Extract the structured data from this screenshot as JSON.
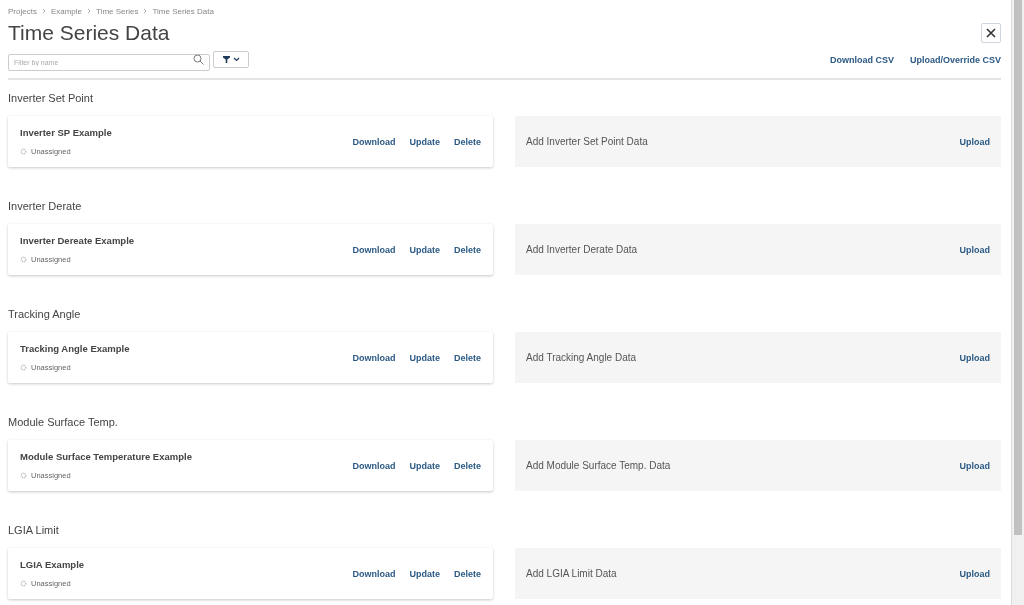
{
  "breadcrumb": [
    "Projects",
    "Example",
    "Time Series",
    "Time Series Data"
  ],
  "title": "Time Series Data",
  "filter": {
    "placeholder": "Filter by name"
  },
  "header_actions": [
    "Download CSV",
    "Upload/Override CSV"
  ],
  "sections": [
    {
      "title": "Inverter Set Point",
      "item": {
        "name": "Inverter SP Example",
        "status": "Unassigned",
        "actions": [
          "Download",
          "Update",
          "Delete"
        ]
      },
      "add": {
        "label": "Add Inverter Set Point Data",
        "action": "Upload"
      }
    },
    {
      "title": "Inverter Derate",
      "item": {
        "name": "Inverter Dereate Example",
        "status": "Unassigned",
        "actions": [
          "Download",
          "Update",
          "Delete"
        ]
      },
      "add": {
        "label": "Add Inverter Derate Data",
        "action": "Upload"
      }
    },
    {
      "title": "Tracking Angle",
      "item": {
        "name": "Tracking Angle Example",
        "status": "Unassigned",
        "actions": [
          "Download",
          "Update",
          "Delete"
        ]
      },
      "add": {
        "label": "Add Tracking Angle Data",
        "action": "Upload"
      }
    },
    {
      "title": "Module Surface Temp.",
      "item": {
        "name": "Module Surface Temperature Example",
        "status": "Unassigned",
        "actions": [
          "Download",
          "Update",
          "Delete"
        ]
      },
      "add": {
        "label": "Add Module Surface Temp. Data",
        "action": "Upload"
      }
    },
    {
      "title": "LGIA Limit",
      "item": {
        "name": "LGIA Example",
        "status": "Unassigned",
        "actions": [
          "Download",
          "Update",
          "Delete"
        ]
      },
      "add": {
        "label": "Add LGIA Limit Data",
        "action": "Upload"
      }
    }
  ]
}
